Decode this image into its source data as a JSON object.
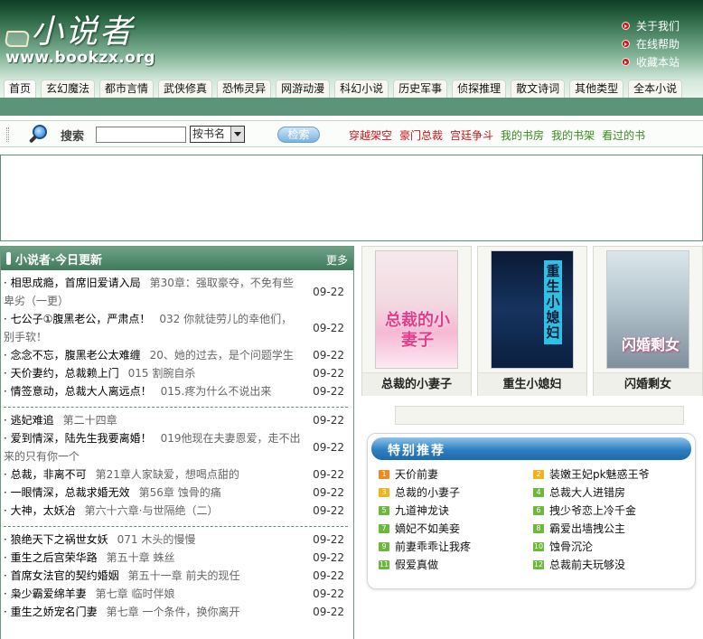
{
  "header": {
    "logo_cn": "小说者",
    "logo_en": "www.bookzx.org",
    "links": [
      "关于我们",
      "在线帮助",
      "收藏本站"
    ]
  },
  "nav": {
    "tabs": [
      "首页",
      "玄幻魔法",
      "都市言情",
      "武侠修真",
      "恐怖灵异",
      "网游动漫",
      "科幻小说",
      "历史军事",
      "侦探推理",
      "散文诗词",
      "其他类型",
      "全本小说"
    ],
    "active_index": 0
  },
  "search": {
    "label": "搜索",
    "input_value": "",
    "select_value": "按书名",
    "button_label": "检索",
    "links": [
      {
        "text": "穿越架空",
        "color": "#d0141b"
      },
      {
        "text": "豪门总裁",
        "color": "#d0141b"
      },
      {
        "text": "宫廷争斗",
        "color": "#d0141b"
      },
      {
        "text": "我的书房",
        "color": "#3a8a1c"
      },
      {
        "text": "我的书架",
        "color": "#3a8a1c"
      },
      {
        "text": "看过的书",
        "color": "#3a8a1c"
      }
    ]
  },
  "updates": {
    "title": "小说者·今日更新",
    "more": "更多",
    "groups": [
      [
        {
          "title": "· 相思成瘾，首席旧爱请入局",
          "chapter": "第30章：强取豪夺，不免有些卑劣（一更）",
          "date": "09-22",
          "wrap": true
        },
        {
          "title": "· 七公子①腹黑老公，严肃点！",
          "chapter": "032 你就徒劳儿的幸他们，别手软！",
          "date": "09-22",
          "wrap": true
        },
        {
          "title": "· 念念不忘，腹黑老公太难缠",
          "chapter": "20、她的过去，是个问题学生",
          "date": "09-22",
          "wrap": false
        },
        {
          "title": "· 天价妻约，总裁赖上门",
          "chapter": "015 割腕自杀",
          "date": "09-22",
          "wrap": false
        },
        {
          "title": "· 情签意动，总裁大人离远点！",
          "chapter": "015.疼为什么不说出来",
          "date": "09-22",
          "wrap": false
        }
      ],
      [
        {
          "title": "· 逃妃难追",
          "chapter": "第二十四章",
          "date": "09-22",
          "wrap": false
        },
        {
          "title": "· 爱到情深，陆先生我要离婚！",
          "chapter": "019他现在夫妻恩爱，走不出来的只有你一个",
          "date": "09-22",
          "wrap": true
        },
        {
          "title": "· 总裁，非离不可",
          "chapter": "第21章人家缺爱，想喝点甜的",
          "date": "09-22",
          "wrap": false
        },
        {
          "title": "· 一眼情深，总裁求婚无效",
          "chapter": "第56章 蚀骨的痛",
          "date": "09-22",
          "wrap": false
        },
        {
          "title": "· 大神，太妖冶",
          "chapter": "第六十六章·与世隔绝（二）",
          "date": "09-22",
          "wrap": false
        }
      ],
      [
        {
          "title": "· 狼绝天下之祸世女妖",
          "chapter": "071 木头的慢慢",
          "date": "09-22",
          "wrap": false
        },
        {
          "title": "· 重生之后宫荣华路",
          "chapter": "第五十章 蛛丝",
          "date": "09-22",
          "wrap": false
        },
        {
          "title": "· 首席女法官的契约婚姻",
          "chapter": "第五十一章 前夫的现任",
          "date": "09-22",
          "wrap": false
        },
        {
          "title": "· 枭少霸爱绵羊妻",
          "chapter": "第七章 临时伴娘",
          "date": "09-22",
          "wrap": false
        },
        {
          "title": "· 重生之娇宠名门妻",
          "chapter": "第七章 一个条件，换你离开",
          "date": "09-22",
          "wrap": false
        }
      ]
    ]
  },
  "books": [
    {
      "caption": "总裁的小妻子",
      "cover_text": "总裁的小妻子",
      "cover_color": "#e83b8a"
    },
    {
      "caption": "重生小媳妇",
      "cover_text": "重生小媳妇",
      "cover_color": "#1a2a5c"
    },
    {
      "caption": "闪婚剩女",
      "cover_text": "闪婚剩女",
      "cover_color": "#c43a6f"
    }
  ],
  "recommend": {
    "title": "特别推荐",
    "items": [
      {
        "num": "1",
        "text": "天价前妻",
        "color": "#f08a1c"
      },
      {
        "num": "2",
        "text": "装嫩王妃pk魅惑王爷",
        "color": "#f0b31c"
      },
      {
        "num": "3",
        "text": "总裁的小妻子",
        "color": "#f0b31c"
      },
      {
        "num": "4",
        "text": "总裁大人进错房",
        "color": "#6cb83a"
      },
      {
        "num": "5",
        "text": "九道神龙诀",
        "color": "#6cb83a"
      },
      {
        "num": "6",
        "text": "拽少爷恋上冷千金",
        "color": "#6cb83a"
      },
      {
        "num": "7",
        "text": "嫡妃不如美妾",
        "color": "#6cb83a"
      },
      {
        "num": "8",
        "text": "霸爱出墙拽公主",
        "color": "#6cb83a"
      },
      {
        "num": "9",
        "text": "前妻乖乖让我疼",
        "color": "#6cb83a"
      },
      {
        "num": "10",
        "text": "蚀骨沉沦",
        "color": "#6cb83a"
      },
      {
        "num": "11",
        "text": "假爱真做",
        "color": "#6cb83a"
      },
      {
        "num": "12",
        "text": "总裁前夫玩够没",
        "color": "#6cb83a"
      }
    ]
  }
}
